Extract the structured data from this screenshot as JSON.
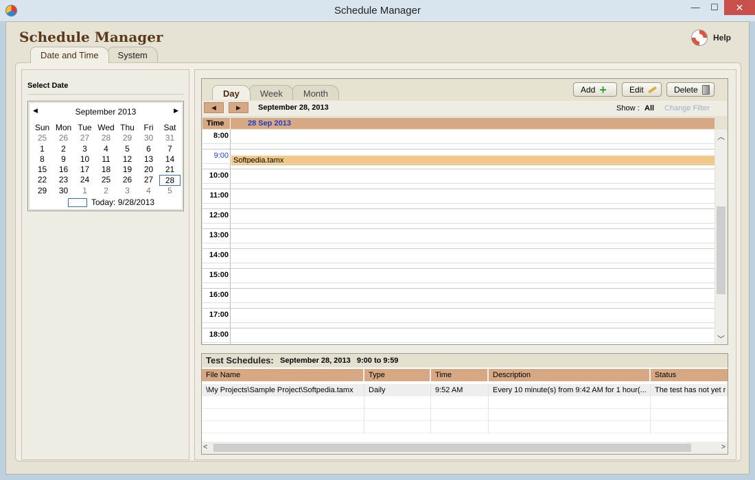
{
  "window": {
    "title": "Schedule Manager",
    "minimize": "—",
    "maximize": "☐",
    "close": "✕"
  },
  "app": {
    "title": "Schedule Manager",
    "help_label": "Help"
  },
  "main_tabs": [
    "Date and Time",
    "System"
  ],
  "left": {
    "select_date_label": "Select Date",
    "calendar": {
      "month_label": "September 2013",
      "prev": "◀",
      "next": "▶",
      "weekdays": [
        "Sun",
        "Mon",
        "Tue",
        "Wed",
        "Thu",
        "Fri",
        "Sat"
      ],
      "weeks": [
        [
          "25",
          "26",
          "27",
          "28",
          "29",
          "30",
          "31"
        ],
        [
          "1",
          "2",
          "3",
          "4",
          "5",
          "6",
          "7"
        ],
        [
          "8",
          "9",
          "10",
          "11",
          "12",
          "13",
          "14"
        ],
        [
          "15",
          "16",
          "17",
          "18",
          "19",
          "20",
          "21"
        ],
        [
          "22",
          "23",
          "24",
          "25",
          "26",
          "27",
          "28"
        ],
        [
          "29",
          "30",
          "1",
          "2",
          "3",
          "4",
          "5"
        ]
      ],
      "selected_day": "28",
      "today_label": "Today: 9/28/2013"
    }
  },
  "schedule": {
    "view_tabs": [
      "Day",
      "Week",
      "Month"
    ],
    "add_label": "Add",
    "edit_label": "Edit",
    "delete_label": "Delete",
    "prev": "◀",
    "next": "▶",
    "current_date": "September 28, 2013",
    "show_label": "Show :",
    "show_value": "All",
    "change_filter": "Change Filter",
    "time_header": "Time",
    "date_header": "28 Sep 2013",
    "hours": [
      "8:00",
      "9:00",
      "10:00",
      "11:00",
      "12:00",
      "13:00",
      "14:00",
      "15:00",
      "16:00",
      "17:00",
      "18:00"
    ],
    "highlight_hour": "9:00",
    "event_label": "Softpedia.tamx",
    "scroll_up": "︿",
    "scroll_down": "﹀"
  },
  "test_schedules": {
    "title": "Test Schedules:",
    "info": "September 28, 2013   9:00 to 9:59",
    "columns": [
      "File Name",
      "Type",
      "Time",
      "Description",
      "Status"
    ],
    "rows": [
      [
        "\\My Projects\\Sample Project\\Softpedia.tamx",
        "Daily",
        "9:52 AM",
        "Every 10 minute(s) from 9:42 AM for 1 hour(...",
        "The test has not yet r"
      ]
    ],
    "scroll_left": "<",
    "scroll_right": ">"
  },
  "colors": {
    "accent_tan": "#d6a883",
    "event_fill": "#f2c887",
    "link_blue": "#1a3ec9",
    "title_brown": "#5a3a1a"
  }
}
